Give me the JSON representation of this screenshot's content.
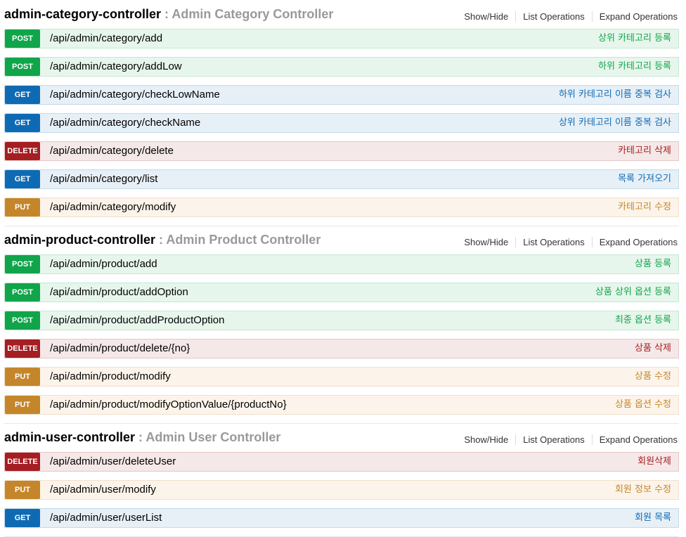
{
  "sections": [
    {
      "name": "admin-category-controller",
      "separator": " : ",
      "description": "Admin Category Controller",
      "links": [
        "Show/Hide",
        "List Operations",
        "Expand Operations"
      ],
      "operations": [
        {
          "method": "POST",
          "path": "/api/admin/category/add",
          "summary": "상위 카테고리 등록"
        },
        {
          "method": "POST",
          "path": "/api/admin/category/addLow",
          "summary": "하위 카테고리 등록"
        },
        {
          "method": "GET",
          "path": "/api/admin/category/checkLowName",
          "summary": "하위 카테고리 이름 중복 검사"
        },
        {
          "method": "GET",
          "path": "/api/admin/category/checkName",
          "summary": "상위 카테고리 이름 중복 검사"
        },
        {
          "method": "DELETE",
          "path": "/api/admin/category/delete",
          "summary": "카테고리 삭제"
        },
        {
          "method": "GET",
          "path": "/api/admin/category/list",
          "summary": "목록 가져오기"
        },
        {
          "method": "PUT",
          "path": "/api/admin/category/modify",
          "summary": "카테고리 수정"
        }
      ]
    },
    {
      "name": "admin-product-controller",
      "separator": " : ",
      "description": "Admin Product Controller",
      "links": [
        "Show/Hide",
        "List Operations",
        "Expand Operations"
      ],
      "operations": [
        {
          "method": "POST",
          "path": "/api/admin/product/add",
          "summary": "상품 등록"
        },
        {
          "method": "POST",
          "path": "/api/admin/product/addOption",
          "summary": "상품 상위 옵션 등록"
        },
        {
          "method": "POST",
          "path": "/api/admin/product/addProductOption",
          "summary": "최종 옵션 등록"
        },
        {
          "method": "DELETE",
          "path": "/api/admin/product/delete/{no}",
          "summary": "상품 삭제"
        },
        {
          "method": "PUT",
          "path": "/api/admin/product/modify",
          "summary": "상품 수정"
        },
        {
          "method": "PUT",
          "path": "/api/admin/product/modifyOptionValue/{productNo}",
          "summary": "상품 옵션 수정"
        }
      ]
    },
    {
      "name": "admin-user-controller",
      "separator": " : ",
      "description": "Admin User Controller",
      "links": [
        "Show/Hide",
        "List Operations",
        "Expand Operations"
      ],
      "operations": [
        {
          "method": "DELETE",
          "path": "/api/admin/user/deleteUser",
          "summary": "회원삭제"
        },
        {
          "method": "PUT",
          "path": "/api/admin/user/modify",
          "summary": "회원 정보 수정"
        },
        {
          "method": "GET",
          "path": "/api/admin/user/userList",
          "summary": "회원 목록"
        }
      ]
    }
  ],
  "colors": {
    "post": "#10a54a",
    "get": "#0f6ab4",
    "delete": "#a41e22",
    "put": "#c5862b",
    "description": "#999999"
  }
}
